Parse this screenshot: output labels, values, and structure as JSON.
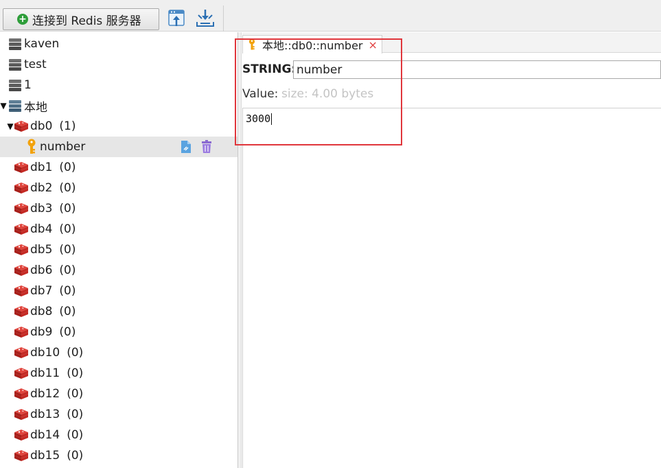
{
  "toolbar": {
    "connect_label": "连接到 Redis 服务器",
    "import_icon": "import-icon",
    "export_icon": "export-icon"
  },
  "tree": {
    "servers": [
      {
        "name": "kaven"
      },
      {
        "name": "test"
      },
      {
        "name": "1"
      }
    ],
    "local_server": {
      "name": "本地",
      "expanded": true
    },
    "databases": [
      {
        "name": "db0",
        "count": "(1)",
        "expanded": true
      },
      {
        "name": "db1",
        "count": "(0)"
      },
      {
        "name": "db2",
        "count": "(0)"
      },
      {
        "name": "db3",
        "count": "(0)"
      },
      {
        "name": "db4",
        "count": "(0)"
      },
      {
        "name": "db5",
        "count": "(0)"
      },
      {
        "name": "db6",
        "count": "(0)"
      },
      {
        "name": "db7",
        "count": "(0)"
      },
      {
        "name": "db8",
        "count": "(0)"
      },
      {
        "name": "db9",
        "count": "(0)"
      },
      {
        "name": "db10",
        "count": "(0)"
      },
      {
        "name": "db11",
        "count": "(0)"
      },
      {
        "name": "db12",
        "count": "(0)"
      },
      {
        "name": "db13",
        "count": "(0)"
      },
      {
        "name": "db14",
        "count": "(0)"
      },
      {
        "name": "db15",
        "count": "(0)"
      }
    ],
    "selected_key": {
      "name": "number"
    }
  },
  "editor": {
    "tab_title": "本地::db0::number",
    "close_glyph": "×",
    "type_label": "STRING:",
    "key_value": "number",
    "value_label": "Value:",
    "value_size": "size: 4.00 bytes",
    "value_content": "3000"
  },
  "colors": {
    "highlight": "#e0353b",
    "redis_red": "#d42b25",
    "key_gold": "#f2a20c",
    "selected_row": "#e6e6e6"
  }
}
